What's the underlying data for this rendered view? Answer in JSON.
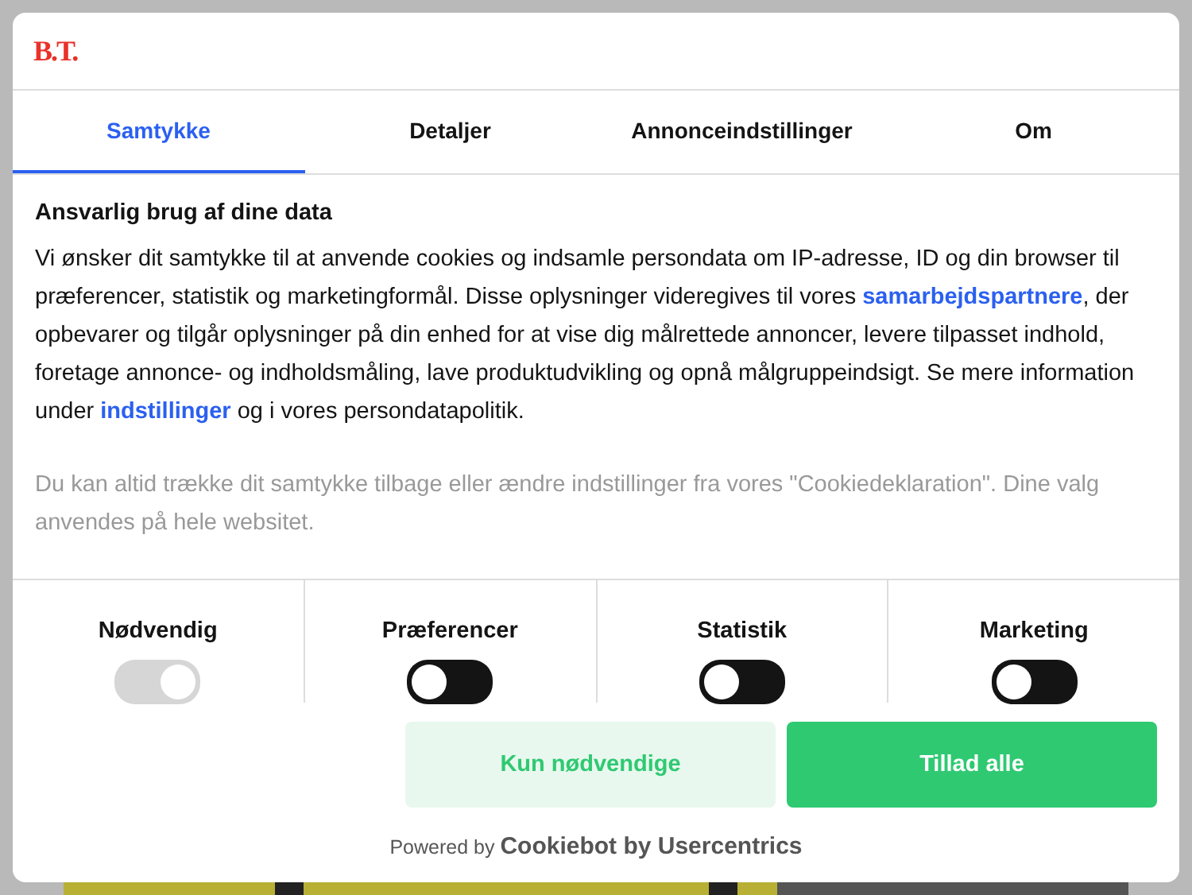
{
  "logo": "B.T.",
  "tabs": [
    {
      "label": "Samtykke",
      "selected": true
    },
    {
      "label": "Detaljer",
      "selected": false
    },
    {
      "label": "Annonceindstillinger",
      "selected": false
    },
    {
      "label": "Om",
      "selected": false
    }
  ],
  "heading": "Ansvarlig brug af dine data",
  "paragraphs": [
    {
      "muted": false,
      "parts": [
        {
          "kind": "text",
          "text": "Vi ønsker dit samtykke til at anvende cookies og indsamle persondata om IP-adresse, ID og din browser til præferencer, statistik og marketingformål. Disse oplysninger videregives til vores "
        },
        {
          "kind": "link",
          "text": "samarbejdspartnere"
        },
        {
          "kind": "text",
          "text": ", der opbevarer og tilgår oplysninger på din enhed for at vise dig målrettede annoncer, levere tilpasset indhold, foretage annonce- og indholdsmåling, lave produktudvikling og opnå målgruppeindsigt. Se mere information under "
        },
        {
          "kind": "link",
          "text": "indstillinger"
        },
        {
          "kind": "text",
          "text": " og i vores persondatapolitik."
        }
      ]
    },
    {
      "muted": true,
      "parts": [
        {
          "kind": "text",
          "text": "Du kan altid trække dit samtykke tilbage eller ændre indstillinger fra vores \"Cookiedeklaration\". Dine valg anvendes på hele websitet."
        }
      ]
    }
  ],
  "categories": [
    {
      "label": "Nødvendig",
      "on": true,
      "disabled": true
    },
    {
      "label": "Præferencer",
      "on": false,
      "disabled": false
    },
    {
      "label": "Statistik",
      "on": false,
      "disabled": false
    },
    {
      "label": "Marketing",
      "on": false,
      "disabled": false
    }
  ],
  "buttons": [
    {
      "label": "Kun nødvendige",
      "kind": "secondary"
    },
    {
      "label": "Tillad alle",
      "kind": "primary"
    }
  ],
  "powered_by": "Powered by **Cookiebot by Usercentrics**"
}
